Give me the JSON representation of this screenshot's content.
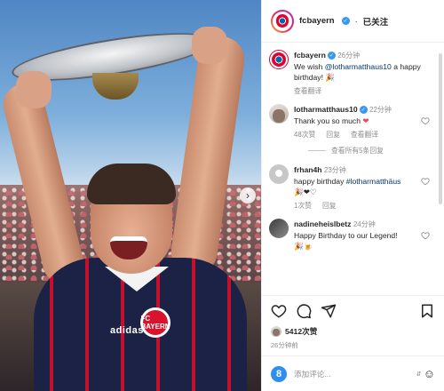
{
  "post": {
    "username": "fcbayern",
    "follow_label": "已关注",
    "dot": "·",
    "caption": {
      "username": "fcbayern",
      "time": "26分钟",
      "text_prefix": "We wish ",
      "mention": "@lotharmatthaus10",
      "text_suffix": " a happy birthday! 🎉",
      "translate": "查看翻译"
    },
    "comments": [
      {
        "username": "lotharmatthaus10",
        "time": "22分钟",
        "text": "Thank you so much",
        "emoji": "❤",
        "likes": "48次赞",
        "reply": "回复",
        "translate": "查看翻译",
        "view_replies": "查看所有5条回复"
      },
      {
        "username": "frhan4h",
        "time": "23分钟",
        "text": "happy birthday ",
        "hashtag": "#lotharmatthäus",
        "emojis": "🎉❤♡",
        "likes": "1次赞",
        "reply": "回复"
      },
      {
        "username": "nadineheislbetz",
        "time": "24分钟",
        "text": "Happy Birthday to our Legend!",
        "emojis": "🎉🍺"
      }
    ],
    "likes_count": "5412次赞",
    "posted_time": "26分钟前",
    "comment_placeholder": "添加评论...",
    "extension_badge": "8",
    "photo": {
      "crest_text": "FC BAYERN",
      "jersey_brand": "adidas",
      "next_arrow": "›"
    }
  }
}
